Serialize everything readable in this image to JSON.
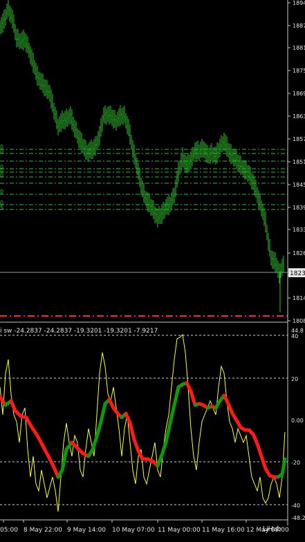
{
  "main_chart": {
    "price_labels": [
      "1894",
      "1887",
      "1881",
      "1875",
      "1869",
      "1863",
      "1857",
      "1851",
      "1845",
      "1839",
      "1833",
      "1826",
      "1820",
      "1814",
      "1808"
    ],
    "current_price": "1823",
    "left_clip_labels": [
      "0",
      "0",
      "0",
      "0",
      "0",
      "0",
      "0",
      "5"
    ],
    "colors": {
      "candles": "#2fbf2f",
      "levels": "#2fbf2f",
      "bid_line": "#9a9a9a",
      "red_level": "#ff2a2a"
    }
  },
  "indicator": {
    "header": "i sw -24.2837 -24.2837 -19.3201 -19.3201 -7.9217",
    "scale_labels": [
      "44.8",
      "40",
      "20",
      "0.00",
      "-20",
      "-40",
      "-48.2"
    ],
    "colors": {
      "yellow": "#ffff33",
      "red": "#ff1a1a",
      "green": "#0a9a0a",
      "levels": "#d9d9d9"
    }
  },
  "time_axis": {
    "labels": [
      "05:00",
      "8 May 22:00",
      "9 May 14:00",
      "10 May 07:00",
      "11 May 00:00",
      "11 May 16:00",
      "12 May 09:00"
    ]
  },
  "watermark": "LiHub"
}
